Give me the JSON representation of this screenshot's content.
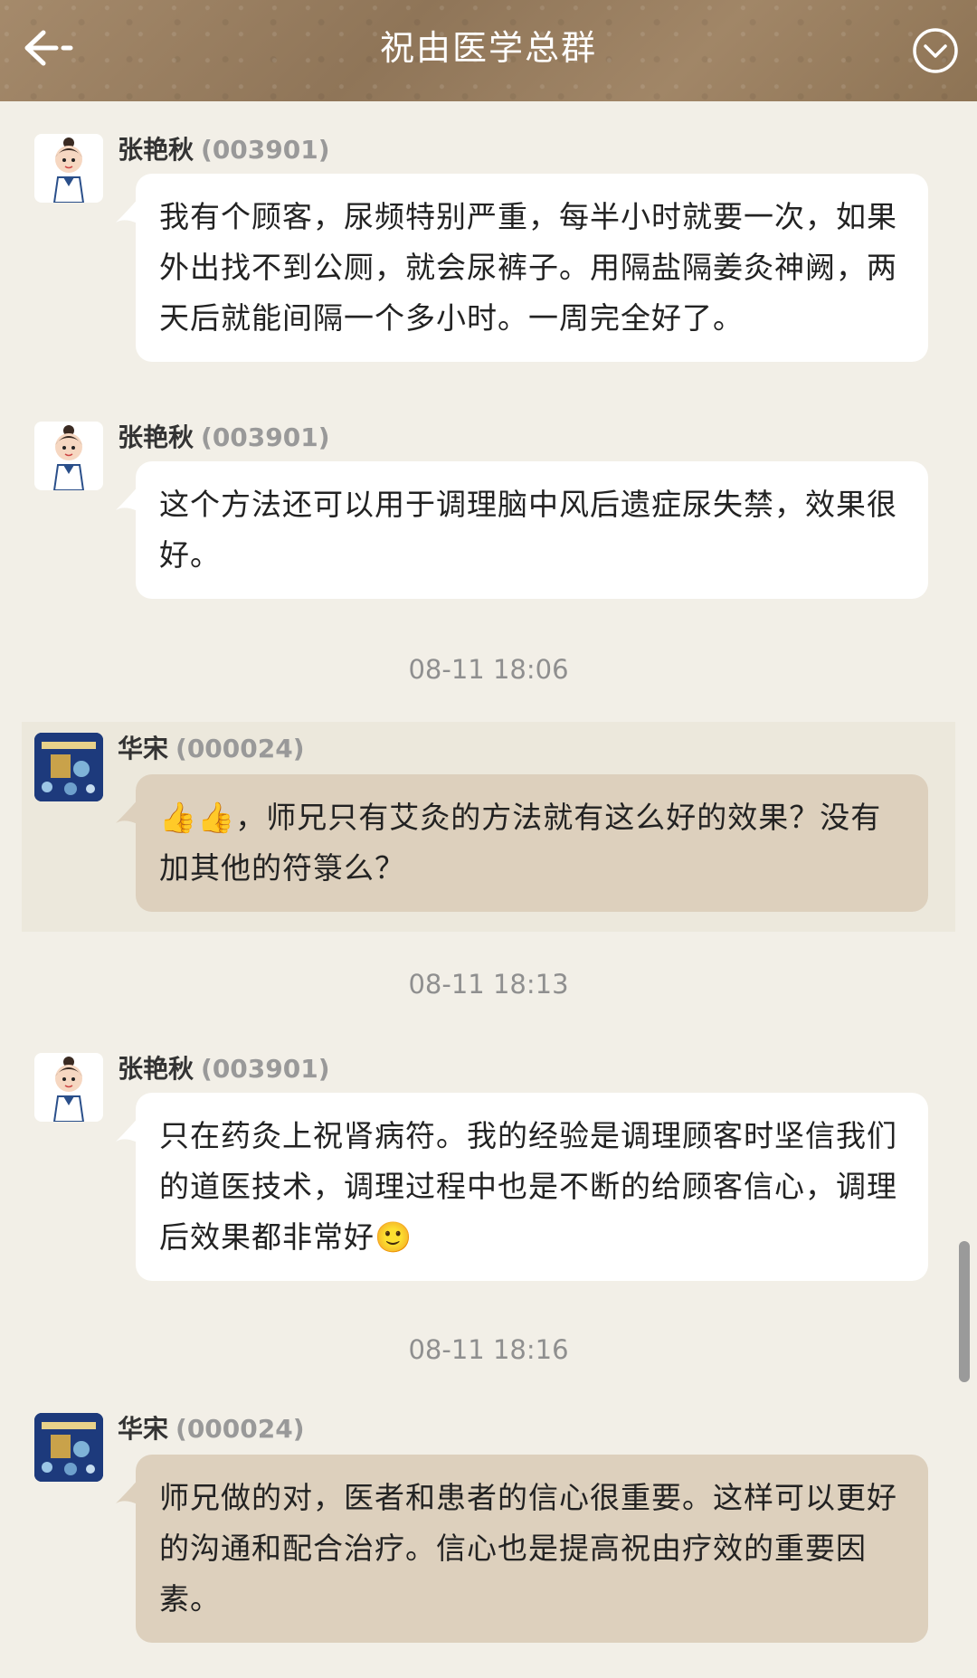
{
  "header": {
    "title": "祝由医学总群"
  },
  "messages": [
    {
      "sender": "张艳秋",
      "id": "(003901)",
      "text": "我有个顾客，尿频特别严重，每半小时就要一次，如果外出找不到公厕，就会尿裤子。用隔盐隔姜灸神阙，两天后就能间隔一个多小时。一周完全好了。"
    },
    {
      "sender": "张艳秋",
      "id": "(003901)",
      "text": "这个方法还可以用于调理脑中风后遗症尿失禁，效果很好。"
    },
    {
      "time": "08-11 18:06"
    },
    {
      "sender": "华宋",
      "id": "(000024)",
      "emoji": "👍👍",
      "text": "，师兄只有艾灸的方法就有这么好的效果？没有加其他的符箓么？"
    },
    {
      "time": "08-11 18:13"
    },
    {
      "sender": "张艳秋",
      "id": "(003901)",
      "text": "只在药灸上祝肾病符。我的经验是调理顾客时坚信我们的道医技术，调理过程中也是不断的给顾客信心，调理后效果都非常好",
      "emoji": "🙂"
    },
    {
      "time": "08-11 18:16"
    },
    {
      "sender": "华宋",
      "id": "(000024)",
      "text": "师兄做的对，医者和患者的信心很重要。这样可以更好的沟通和配合治疗。信心也是提高祝由疗效的重要因素。"
    }
  ],
  "colors": {
    "header_bg": "#9a7f61",
    "page_bg": "#f2efe7",
    "bubble_white": "#ffffff",
    "bubble_tan": "#ddd0bd"
  },
  "icons": [
    "back-arrow-icon",
    "chevron-down-circle-icon"
  ]
}
